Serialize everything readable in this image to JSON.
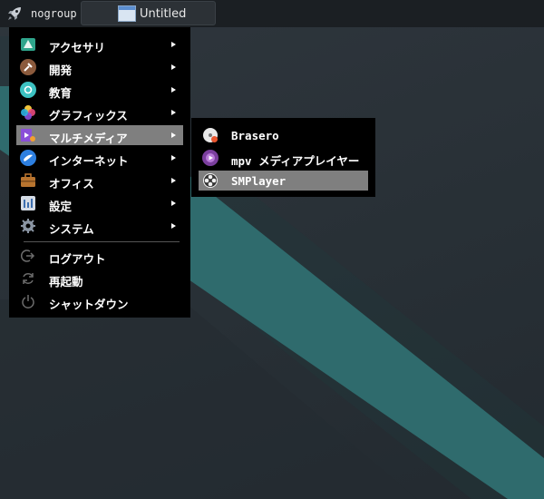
{
  "panel": {
    "launcher_icon": "rocket-icon",
    "user": "nogroup",
    "task": {
      "label": "Untitled",
      "icon": "window-icon"
    }
  },
  "main_menu": {
    "items": [
      {
        "label": "アクセサリ",
        "icon": "accessories-icon",
        "color": "#2fa58c",
        "submenu": true
      },
      {
        "label": "開発",
        "icon": "development-icon",
        "color": "#8b5a3c",
        "submenu": true
      },
      {
        "label": "教育",
        "icon": "education-icon",
        "color": "#3cc1c1",
        "submenu": true
      },
      {
        "label": "グラフィックス",
        "icon": "graphics-icon",
        "color": "#e8497c",
        "submenu": true
      },
      {
        "label": "マルチメディア",
        "icon": "multimedia-icon",
        "color": "#8a4fd8",
        "submenu": true,
        "highlighted": true
      },
      {
        "label": "インターネット",
        "icon": "internet-icon",
        "color": "#2d7fe0",
        "submenu": true
      },
      {
        "label": "オフィス",
        "icon": "office-icon",
        "color": "#b8742f",
        "submenu": true
      },
      {
        "label": "設定",
        "icon": "settings-icon",
        "color": "#d5dce6",
        "submenu": true
      },
      {
        "label": "システム",
        "icon": "system-icon",
        "color": "#8a95a3",
        "submenu": true
      }
    ],
    "actions": [
      {
        "label": "ログアウト",
        "icon": "logout-icon"
      },
      {
        "label": "再起動",
        "icon": "restart-icon"
      },
      {
        "label": "シャットダウン",
        "icon": "shutdown-icon"
      }
    ]
  },
  "multimedia_menu": {
    "items": [
      {
        "label": "Brasero",
        "icon": "brasero-icon",
        "color": "#e8e8e8"
      },
      {
        "label": "mpv メディアプレイヤー",
        "icon": "mpv-icon",
        "color": "#7b3f9e"
      },
      {
        "label": "SMPlayer",
        "icon": "smplayer-icon",
        "color": "#f0f0f0",
        "highlighted": true
      }
    ]
  }
}
